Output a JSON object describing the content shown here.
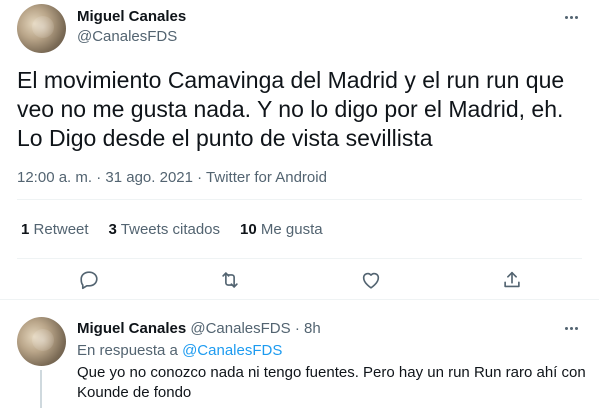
{
  "tweet": {
    "author_name": "Miguel Canales",
    "author_handle": "@CanalesFDS",
    "text": "El movimiento Camavinga del Madrid y el run run que veo no me gusta nada. Y no lo digo por el Madrid, eh. Lo Digo desde el punto de vista sevillista",
    "time": "12:00 a. m.",
    "sep1": " · ",
    "date": "31 ago. 2021",
    "sep2": " · ",
    "source": "Twitter for Android",
    "stats": {
      "retweets_count": "1",
      "retweets_label": "Retweet",
      "quotes_count": "3",
      "quotes_label": "Tweets citados",
      "likes_count": "10",
      "likes_label": "Me gusta"
    },
    "icons": [
      "reply-icon",
      "retweet-icon",
      "like-icon",
      "share-icon"
    ]
  },
  "reply": {
    "author_name": "Miguel Canales",
    "author_handle": "@CanalesFDS",
    "dot": "·",
    "time": "8h",
    "replying_prefix": "En respuesta a",
    "replying_to": "@CanalesFDS",
    "text": "Que yo no conozco nada ni tengo fuentes. Pero hay un run Run raro ahí con Kounde de fondo"
  },
  "colors": {
    "text": "#0f1419",
    "muted": "#536471",
    "link": "#1d9bf0",
    "border": "#eff3f4"
  }
}
